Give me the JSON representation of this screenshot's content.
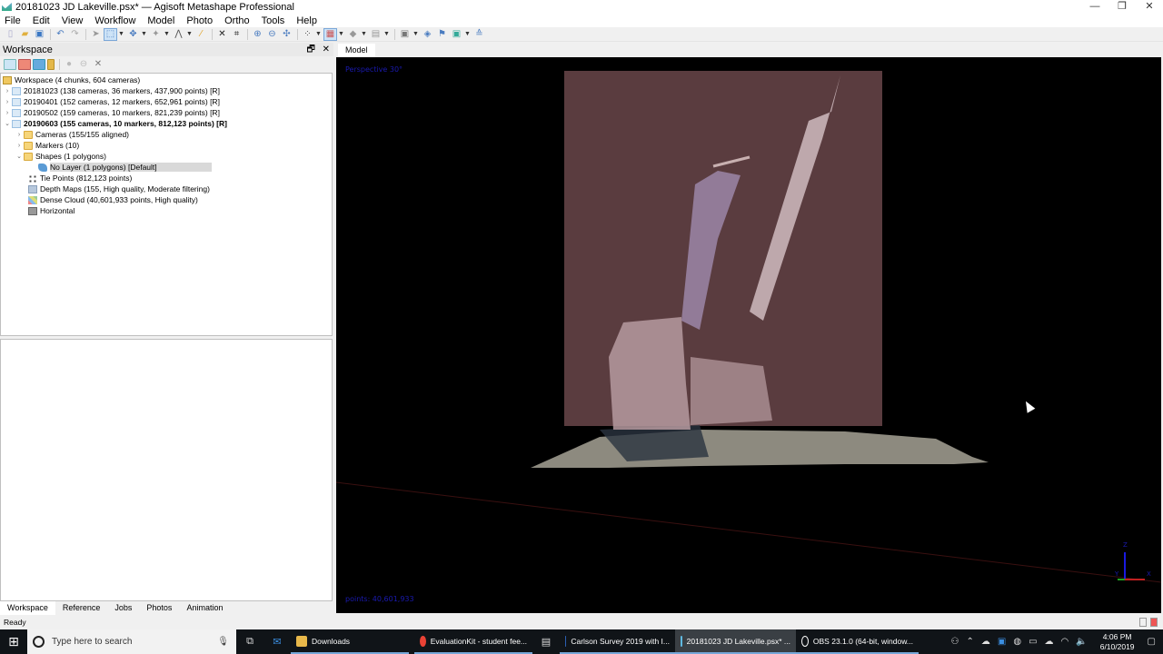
{
  "window": {
    "title": "20181023 JD Lakeville.psx* — Agisoft Metashape Professional",
    "controls": {
      "minimize": "—",
      "restore": "❐",
      "close": "✕"
    }
  },
  "menu": [
    "File",
    "Edit",
    "View",
    "Workflow",
    "Model",
    "Photo",
    "Ortho",
    "Tools",
    "Help"
  ],
  "toolbar": {
    "icons": [
      "new-icon",
      "open-icon",
      "save-icon",
      "undo-icon",
      "redo-icon",
      "navigation-icon",
      "rectangle-selection-icon",
      "move-object-icon",
      "move-region-icon",
      "ruler-icon",
      "tape-measure-icon",
      "delete-icon",
      "crop-icon",
      "zoom-in-icon",
      "zoom-out-icon",
      "reset-view-icon",
      "point-cloud-icon",
      "dense-cloud-icon",
      "shaded-model-icon",
      "tiled-model-icon",
      "show-cameras-icon",
      "show-markers-icon",
      "show-shapes-icon",
      "show-region-icon",
      "show-grid-icon"
    ]
  },
  "workspace_panel": {
    "title": "Workspace",
    "float_btn": "🗗",
    "close_btn": "✕",
    "tree": [
      {
        "level": 0,
        "arrow": "",
        "icon": "ws",
        "label": "Workspace (4 chunks, 604 cameras)"
      },
      {
        "level": 0,
        "arrow": "›",
        "icon": "chunk",
        "label": "20181023 (138 cameras, 36 markers, 437,900 points) [R]"
      },
      {
        "level": 0,
        "arrow": "›",
        "icon": "chunk",
        "label": "20190401 (152 cameras, 12 markers, 652,961 points) [R]"
      },
      {
        "level": 0,
        "arrow": "›",
        "icon": "chunk",
        "label": "20190502 (159 cameras, 10 markers, 821,239 points) [R]"
      },
      {
        "level": 0,
        "arrow": "⌄",
        "icon": "chunk",
        "label": "20190603 (155 cameras, 10 markers, 812,123 points) [R]",
        "bold": true
      },
      {
        "level": 1,
        "arrow": "›",
        "icon": "folder",
        "label": "Cameras (155/155 aligned)"
      },
      {
        "level": 1,
        "arrow": "›",
        "icon": "folder",
        "label": "Markers (10)"
      },
      {
        "level": 1,
        "arrow": "⌄",
        "icon": "folder",
        "label": "Shapes (1 polygons)"
      },
      {
        "level": 2,
        "arrow": "",
        "icon": "shape",
        "label": "No Layer (1 polygons) [Default]",
        "selected": true
      },
      {
        "level": 1,
        "arrow": "",
        "icon": "tie",
        "label": "Tie Points (812,123 points)"
      },
      {
        "level": 1,
        "arrow": "",
        "icon": "depth",
        "label": "Depth Maps (155, High quality, Moderate filtering)"
      },
      {
        "level": 1,
        "arrow": "",
        "icon": "dense",
        "label": "Dense Cloud (40,601,933 points, High quality)"
      },
      {
        "level": 1,
        "arrow": "",
        "icon": "ortho",
        "label": "Horizontal"
      }
    ]
  },
  "bottom_tabs": [
    "Workspace",
    "Reference",
    "Jobs",
    "Photos",
    "Animation"
  ],
  "status": "Ready",
  "model_view": {
    "tab": "Model",
    "projection_label": "Perspective 30°",
    "points_label": "points: 40,601,933",
    "axes": {
      "z": "Z",
      "y": "Y",
      "x": "X"
    }
  },
  "taskbar": {
    "search_placeholder": "Type here to search",
    "apps": [
      {
        "label": "Downloads",
        "color": "#e8b84a"
      },
      {
        "label": "EvaluationKit - student fee...",
        "color": "#e94235"
      },
      {
        "label": "Carlson Survey 2019 with I...",
        "color": "#2b5fb3"
      },
      {
        "label": "20181023 JD Lakeville.psx* ...",
        "color": "#5fb9e0",
        "active": true
      },
      {
        "label": "OBS 23.1.0 (64-bit, window...",
        "color": "#333"
      }
    ],
    "time": "4:06 PM",
    "date": "6/10/2019"
  }
}
